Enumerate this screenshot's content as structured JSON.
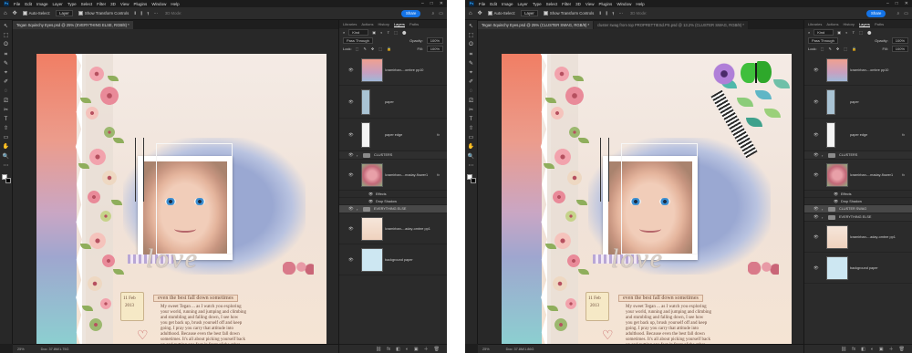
{
  "menu": [
    "File",
    "Edit",
    "Image",
    "Layer",
    "Type",
    "Select",
    "Filter",
    "3D",
    "View",
    "Plugins",
    "Window",
    "Help"
  ],
  "window_controls": [
    "–",
    "□",
    "✕"
  ],
  "options_bar": {
    "auto_select_label": "Auto-Select:",
    "layer_select_value": "Layer",
    "show_transform_label": "Show Transform Controls",
    "mode_label": "3D Mode:",
    "share_label": "Share"
  },
  "tools": [
    "↖",
    "⬚",
    "ʘ",
    "⌗",
    "✎",
    "⌖",
    "✐",
    "◌",
    "⎚",
    "✂",
    "T",
    "⇧",
    "▭",
    "✋",
    "🔍",
    "⋯"
  ],
  "left": {
    "doc_tab": "Tegan Squinchy Eyes.psd @ 25% (EVERYTHING ELSE, RGB/8) *",
    "status_zoom": "25%",
    "status_doc": "Doc: 37.8M/1.75G",
    "layers": [
      {
        "kind": "layer",
        "name": "lcramirban-...ombre pp10",
        "thumb": "pink-ombre"
      },
      {
        "kind": "layer",
        "name": "paper",
        "thumb": "blue"
      },
      {
        "kind": "layer",
        "name": "paper edge",
        "thumb": "white",
        "fx": "fx"
      },
      {
        "kind": "group",
        "name": "CLUSTERS"
      },
      {
        "kind": "layer",
        "name": "lcramirban-...maday-flower1",
        "thumb": "flower",
        "fx": "fx"
      },
      {
        "kind": "effect",
        "name": "Effects"
      },
      {
        "kind": "effect",
        "name": "Drop Shadow"
      },
      {
        "kind": "group",
        "name": "EVERYTHING ELSE",
        "selected": true
      },
      {
        "kind": "layer",
        "name": "lcramirban-...aday-ombre pp1",
        "thumb": "pale"
      },
      {
        "kind": "layer",
        "name": "background paper",
        "thumb": "lightblue"
      }
    ]
  },
  "right": {
    "doc_tab": "Tegan Squinchy Eyes.psd @ 25% (CLUSTER SWAG, RGB/8) *",
    "doc_tab2": "cluster swag from top PROPRETTIESd.PS.psd @ 13.2% (CLUSTER SWAG, RGB/8) *",
    "status_zoom": "25%",
    "status_doc": "Doc: 37.8M/1.86G",
    "layers": [
      {
        "kind": "layer",
        "name": "lcramirban-...ombre pp10",
        "thumb": "pink-ombre"
      },
      {
        "kind": "layer",
        "name": "paper",
        "thumb": "blue"
      },
      {
        "kind": "layer",
        "name": "paper edge",
        "thumb": "white",
        "fx": "fx"
      },
      {
        "kind": "group",
        "name": "CLUSTERS"
      },
      {
        "kind": "layer",
        "name": "lcramirban-...maday-flower1",
        "thumb": "flower",
        "fx": "fx"
      },
      {
        "kind": "effect",
        "name": "Effects"
      },
      {
        "kind": "effect",
        "name": "Drop Shadow"
      },
      {
        "kind": "group",
        "name": "CLUSTER SWAG",
        "selected": true
      },
      {
        "kind": "group",
        "name": "EVERYTHING ELSE"
      },
      {
        "kind": "layer",
        "name": "lcramirban-...aday-ombre pp1",
        "thumb": "pale"
      },
      {
        "kind": "layer",
        "name": "background paper",
        "thumb": "lightblue"
      }
    ]
  },
  "panel": {
    "tabs": [
      "Libraries",
      "Actions",
      "History",
      "Layers",
      "Paths"
    ],
    "active_tab": "Layers",
    "kind_label": "Kind",
    "blend_mode": "Pass Through",
    "opacity_label": "Opacity:",
    "opacity_value": "100%",
    "lock_label": "Lock:",
    "fill_label": "Fill:",
    "fill_value": "100%",
    "footer_icons": [
      "⛓",
      "fx",
      "◧",
      "◐",
      "▣",
      "＋",
      "🗑"
    ]
  },
  "artwork": {
    "title_word": "love",
    "phrase": "even the best fall down sometimes",
    "date_line1": "11 Feb",
    "date_line2": "2013",
    "journal": [
      "My sweet Tegan ... as I watch you exploring",
      "your world, running and jumping and climbing",
      "and stumbling and falling down, I see how",
      "you get back up, brush yourself off and keep",
      "going. I pray you carry that attitude into",
      "adulthood. Because even the best fall down",
      "sometimes. It's all about picking yourself back",
      "up and putting one foot in front of the other."
    ]
  }
}
